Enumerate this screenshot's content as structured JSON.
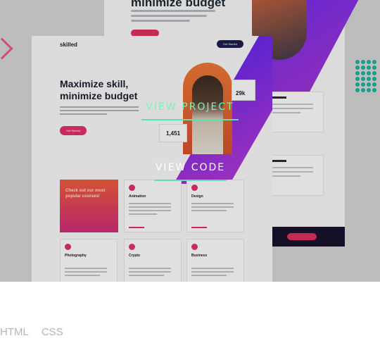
{
  "back_site": {
    "heading": "minimize budget",
    "stat_label": "1,451"
  },
  "site": {
    "logo": "skilled",
    "nav_button": "Get Started",
    "headline_line1": "Maximize skill,",
    "headline_line2": "minimize budget",
    "cta": "Get Started",
    "stat_students": "29k",
    "stat_courses": "1,451",
    "promo": "Check out our most popular courses!",
    "tiles": [
      {
        "title": "Animation"
      },
      {
        "title": "Design"
      },
      {
        "title": "Photography"
      },
      {
        "title": "Crypto"
      },
      {
        "title": "Business"
      }
    ]
  },
  "overlay": {
    "view_project": "VIEW PROJECT",
    "view_code": "VIEW CODE"
  },
  "tags": [
    "HTML",
    "CSS"
  ],
  "colors": {
    "accent_green": "#5fe0ae",
    "brand_pink": "#e33268",
    "brand_purple": "#6428ee",
    "tag_gray": "#b5b5b5"
  }
}
